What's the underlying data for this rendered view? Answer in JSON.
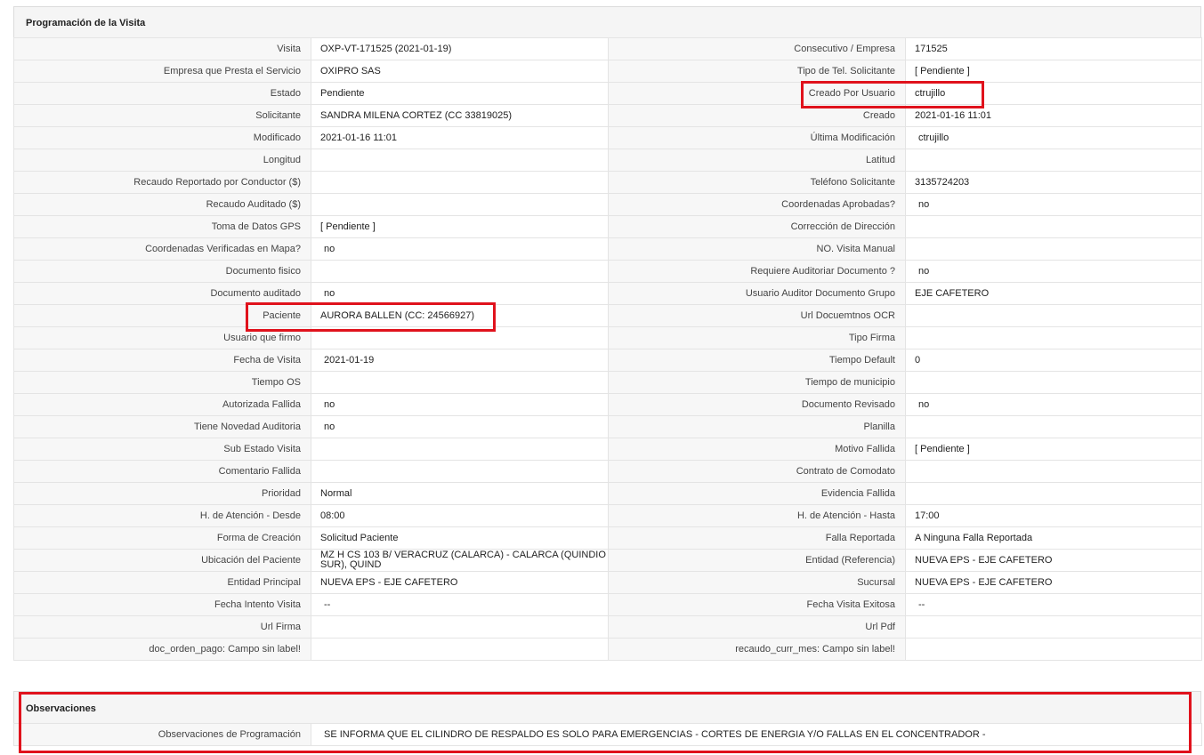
{
  "section_title": "Programación de la Visita",
  "rows": [
    {
      "l1": "Visita",
      "v1": "OXP-VT-171525 (2021-01-19)",
      "l2": "Consecutivo / Empresa",
      "v2": "171525"
    },
    {
      "l1": "Empresa que Presta el Servicio",
      "v1": "OXIPRO SAS",
      "l2": "Tipo de Tel. Solicitante",
      "v2": "[ Pendiente ]"
    },
    {
      "l1": "Estado",
      "v1": "Pendiente",
      "l2": "Creado Por Usuario",
      "v2": "ctrujillo"
    },
    {
      "l1": "Solicitante",
      "v1": "SANDRA MILENA CORTEZ (CC 33819025)",
      "l2": "Creado",
      "v2": "2021-01-16 11:01"
    },
    {
      "l1": "Modificado",
      "v1": "2021-01-16 11:01",
      "l2": "Última Modificación",
      "v2": "ctrujillo"
    },
    {
      "l1": "Longitud",
      "v1": "",
      "l2": "Latitud",
      "v2": ""
    },
    {
      "l1": "Recaudo Reportado por Conductor ($)",
      "v1": "",
      "l2": "Teléfono Solicitante",
      "v2": "3135724203"
    },
    {
      "l1": "Recaudo Auditado ($)",
      "v1": "",
      "l2": "Coordenadas Aprobadas?",
      "v2": "no"
    },
    {
      "l1": "Toma de Datos GPS",
      "v1": "[ Pendiente ]",
      "l2": "Corrección de Dirección",
      "v2": ""
    },
    {
      "l1": "Coordenadas Verificadas en Mapa?",
      "v1": "no",
      "l2": "NO. Visita Manual",
      "v2": ""
    },
    {
      "l1": "Documento fisico",
      "v1": "",
      "l2": "Requiere Auditoriar Documento ?",
      "v2": "no"
    },
    {
      "l1": "Documento auditado",
      "v1": "no",
      "l2": "Usuario Auditor Documento Grupo",
      "v2": "EJE CAFETERO"
    },
    {
      "l1": "Paciente",
      "v1": "AURORA BALLEN (CC: 24566927)",
      "l2": "Url Docuemtnos OCR",
      "v2": ""
    },
    {
      "l1": "Usuario que firmo",
      "v1": "",
      "l2": "Tipo Firma",
      "v2": ""
    },
    {
      "l1": "Fecha de Visita",
      "v1": "2021-01-19",
      "l2": "Tiempo Default",
      "v2": "0"
    },
    {
      "l1": "Tiempo OS",
      "v1": "",
      "l2": "Tiempo de municipio",
      "v2": ""
    },
    {
      "l1": "Autorizada Fallida",
      "v1": "no",
      "l2": "Documento Revisado",
      "v2": "no"
    },
    {
      "l1": "Tiene Novedad Auditoria",
      "v1": "no",
      "l2": "Planilla",
      "v2": ""
    },
    {
      "l1": "Sub Estado Visita",
      "v1": "",
      "l2": "Motivo Fallida",
      "v2": "[ Pendiente ]"
    },
    {
      "l1": "Comentario Fallida",
      "v1": "",
      "l2": "Contrato de Comodato",
      "v2": ""
    },
    {
      "l1": "Prioridad",
      "v1": "Normal",
      "l2": "Evidencia Fallida",
      "v2": ""
    },
    {
      "l1": "H. de Atención - Desde",
      "v1": "08:00",
      "l2": "H. de Atención - Hasta",
      "v2": "17:00"
    },
    {
      "l1": "Forma de Creación",
      "v1": "Solicitud Paciente",
      "l2": "Falla Reportada",
      "v2": "A Ninguna Falla Reportada"
    },
    {
      "l1": "Ubicación del Paciente",
      "v1": "MZ H CS 103 B/ VERACRUZ (CALARCA) - CALARCA (QUINDIO SUR), QUIND",
      "l2": "Entidad (Referencia)",
      "v2": "NUEVA EPS - EJE CAFETERO"
    },
    {
      "l1": "Entidad Principal",
      "v1": "NUEVA EPS - EJE CAFETERO",
      "l2": "Sucursal",
      "v2": "NUEVA EPS - EJE CAFETERO"
    },
    {
      "l1": "Fecha Intento Visita",
      "v1": "--",
      "l2": "Fecha Visita Exitosa",
      "v2": "--"
    },
    {
      "l1": "Url Firma",
      "v1": "",
      "l2": "Url Pdf",
      "v2": ""
    },
    {
      "l1": "doc_orden_pago: Campo sin label!",
      "v1": "",
      "l2": "recaudo_curr_mes: Campo sin label!",
      "v2": ""
    }
  ],
  "observaciones": {
    "title": "Observaciones",
    "label": "Observaciones de Programación",
    "value": "SE INFORMA QUE EL CILINDRO DE RESPALDO ES SOLO PARA EMERGENCIAS - CORTES DE ENERGIA Y/O FALLAS EN EL CONCENTRADOR -"
  },
  "highlight_color": "#e0121c"
}
